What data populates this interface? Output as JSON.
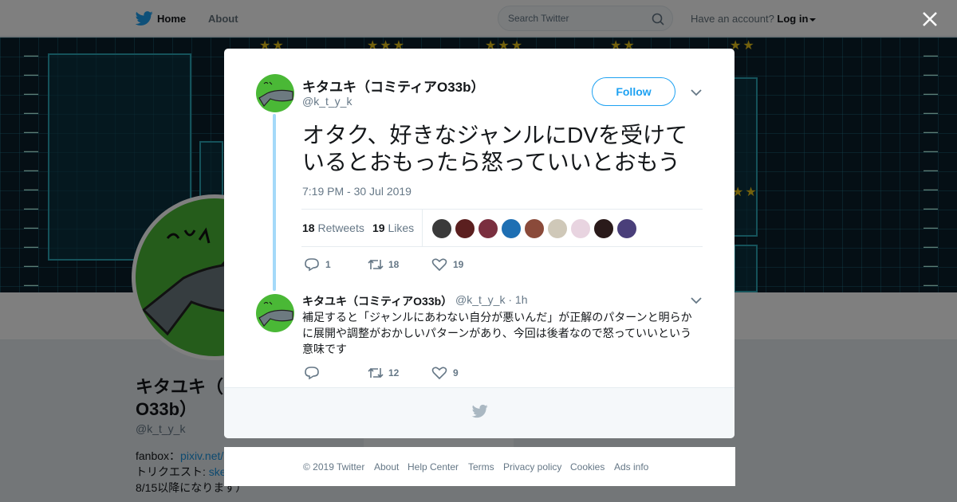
{
  "nav": {
    "home": "Home",
    "about": "About",
    "search_placeholder": "Search Twitter",
    "account_prompt": "Have an account?",
    "login": "Log in"
  },
  "profile": {
    "name_line1": "キタユキ（",
    "name_line2": "O33b）",
    "handle": "@k_t_y_k",
    "bio_fanbox_label": "fanbox：",
    "bio_fanbox_link": "pixiv.net/",
    "bio_request_label": "トリクエスト: ",
    "bio_request_link": "ske",
    "bio_line3": "8/15以降になります）"
  },
  "tweet": {
    "name": "キタユキ（コミティアO33b）",
    "handle": "@k_t_y_k",
    "follow": "Follow",
    "text": "オタク、好きなジャンルにDVを受けているとおもったら怒っていいとおもう",
    "time": "7:19 PM - 30 Jul 2019",
    "retweets_count": "18",
    "retweets_label": "Retweets",
    "likes_count": "19",
    "likes_label": "Likes",
    "actions": {
      "replies": "1",
      "retweets": "18",
      "likes": "19"
    },
    "liker_colors": [
      "#3a3a3a",
      "#5b1f1f",
      "#7a2f3f",
      "#1e6fb3",
      "#8a4a3a",
      "#cfc8b8",
      "#e8d4e0",
      "#2a1a1a",
      "#4a3f7a"
    ]
  },
  "reply": {
    "name": "キタユキ（コミティアO33b）",
    "handle": "@k_t_y_k",
    "time": "· 1h",
    "text": "補足すると「ジャンルにあわない自分が悪いんだ」が正解のパターンと明らかに展開や調整がおかしいパターンがあり、今回は後者なので怒っていいという意味です",
    "actions": {
      "retweets": "12",
      "likes": "9"
    }
  },
  "footer": {
    "copyright": "© 2019 Twitter",
    "about": "About",
    "help": "Help Center",
    "terms": "Terms",
    "privacy": "Privacy policy",
    "cookies": "Cookies",
    "ads": "Ads info"
  },
  "colors": {
    "brand": "#1da1f2",
    "avatar_green": "#4ab836"
  }
}
